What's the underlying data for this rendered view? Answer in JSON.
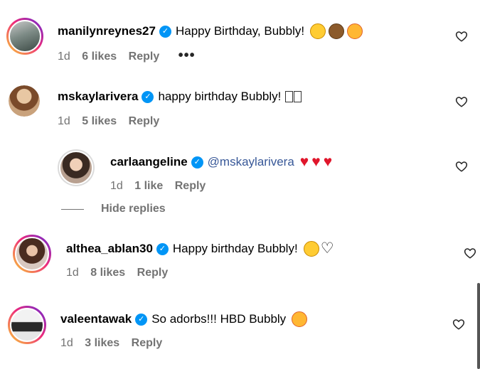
{
  "comments": [
    {
      "username": "manilynreynes27",
      "text": "Happy Birthday, Bubbly!",
      "emojis": [
        "smiling-face-emoji",
        "cake-emoji",
        "smiling-face-with-hearts-emoji"
      ],
      "time": "1d",
      "likes": "6 likes",
      "reply": "Reply",
      "more": "•••"
    },
    {
      "username": "mskaylarivera",
      "text": "happy birthday Bubbly!",
      "time": "1d",
      "likes": "5 likes",
      "reply": "Reply"
    },
    {
      "username": "carlaangeline",
      "text": "@mskaylarivera",
      "emojis": [
        "red-heart-emoji",
        "red-heart-emoji",
        "red-heart-emoji"
      ],
      "time": "1d",
      "likes": "1 like",
      "reply": "Reply"
    },
    {
      "username": "althea_ablan30",
      "text": "Happy birthday Bubbly!",
      "emojis": [
        "hugging-face-emoji",
        "white-heart-emoji"
      ],
      "time": "1d",
      "likes": "8 likes",
      "reply": "Reply"
    },
    {
      "username": "valeentawak",
      "text": "So adorbs!!! HBD Bubbly",
      "emojis": [
        "smiling-face-with-hearts-emoji"
      ],
      "time": "1d",
      "likes": "3 likes",
      "reply": "Reply"
    }
  ],
  "hide_replies": "Hide replies",
  "colors": {
    "verified": "#0095f6",
    "meta": "#737373",
    "mention": "#385898",
    "red_heart": "#e0162b"
  }
}
